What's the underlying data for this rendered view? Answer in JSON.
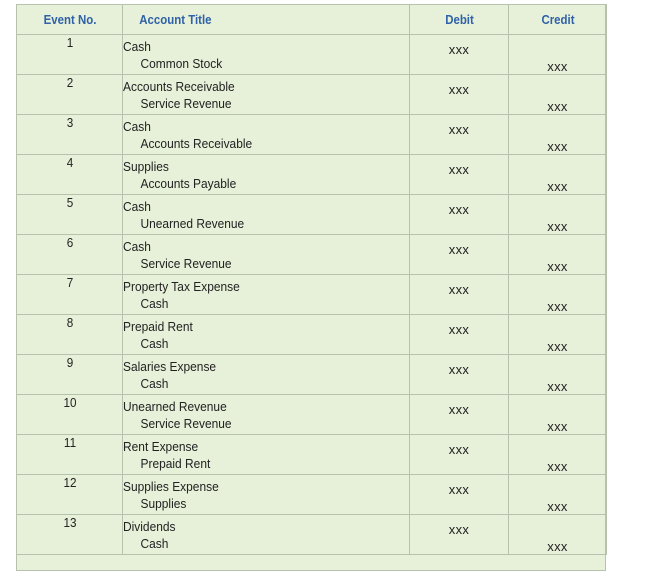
{
  "headers": {
    "event": "Event No.",
    "title": "Account Title",
    "debit": "Debit",
    "credit": "Credit"
  },
  "rows": [
    {
      "event": "1",
      "debit_account": "Cash",
      "credit_account": "Common Stock",
      "debit": "xxx",
      "credit": "xxx"
    },
    {
      "event": "2",
      "debit_account": "Accounts Receivable",
      "credit_account": "Service Revenue",
      "debit": "xxx",
      "credit": "xxx"
    },
    {
      "event": "3",
      "debit_account": "Cash",
      "credit_account": "Accounts Receivable",
      "debit": "xxx",
      "credit": "xxx"
    },
    {
      "event": "4",
      "debit_account": "Supplies",
      "credit_account": "Accounts Payable",
      "debit": "xxx",
      "credit": "xxx"
    },
    {
      "event": "5",
      "debit_account": "Cash",
      "credit_account": "Unearned Revenue",
      "debit": "xxx",
      "credit": "xxx"
    },
    {
      "event": "6",
      "debit_account": "Cash",
      "credit_account": "Service Revenue",
      "debit": "xxx",
      "credit": "xxx"
    },
    {
      "event": "7",
      "debit_account": "Property Tax Expense",
      "credit_account": "Cash",
      "debit": "xxx",
      "credit": "xxx"
    },
    {
      "event": "8",
      "debit_account": "Prepaid Rent",
      "credit_account": "Cash",
      "debit": "xxx",
      "credit": "xxx"
    },
    {
      "event": "9",
      "debit_account": "Salaries Expense",
      "credit_account": "Cash",
      "debit": "xxx",
      "credit": "xxx"
    },
    {
      "event": "10",
      "debit_account": "Unearned Revenue",
      "credit_account": "Service Revenue",
      "debit": "xxx",
      "credit": "xxx"
    },
    {
      "event": "11",
      "debit_account": "Rent Expense",
      "credit_account": "Prepaid Rent",
      "debit": "xxx",
      "credit": "xxx"
    },
    {
      "event": "12",
      "debit_account": "Supplies Expense",
      "credit_account": "Supplies",
      "debit": "xxx",
      "credit": "xxx"
    },
    {
      "event": "13",
      "debit_account": "Dividends",
      "credit_account": "Cash",
      "debit": "xxx",
      "credit": "xxx"
    }
  ],
  "colors": {
    "background": "#e7f0d9",
    "header_text": "#2f62a8",
    "grid": "#b7c2ae"
  }
}
